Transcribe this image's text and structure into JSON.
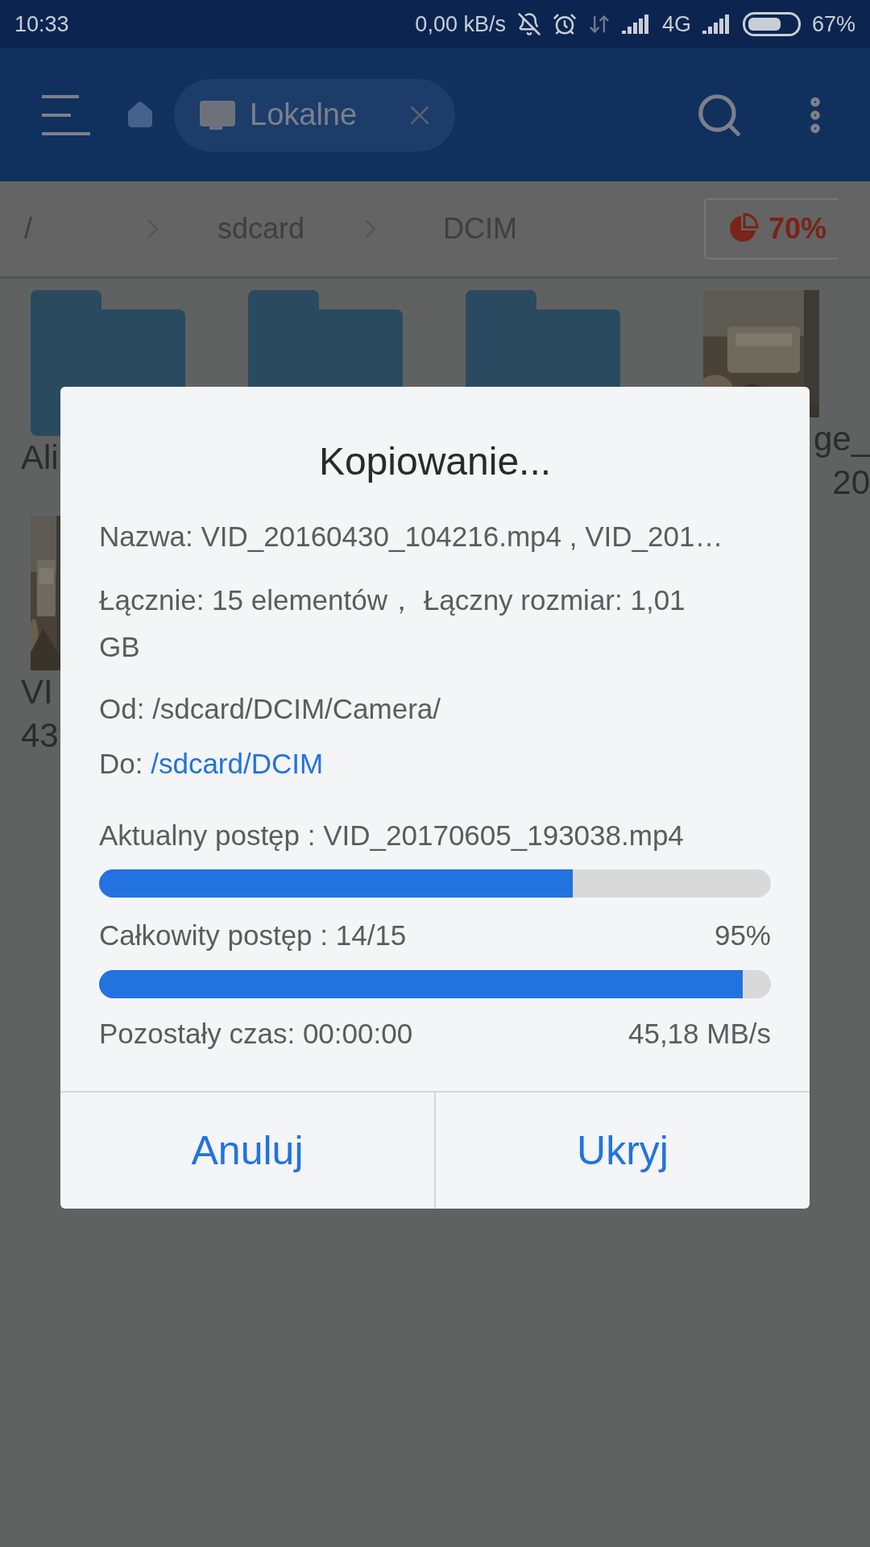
{
  "status_bar": {
    "time": "10:33",
    "net_speed": "0,00 kB/s",
    "network": "4G",
    "battery": "67%"
  },
  "toolbar": {
    "location_chip": "Lokalne"
  },
  "breadcrumb": {
    "items": [
      "/",
      "sdcard",
      "DCIM"
    ],
    "storage_usage": "70%"
  },
  "files": [
    {
      "kind": "folder",
      "label_lines": [
        "Ali"
      ]
    },
    {
      "kind": "folder"
    },
    {
      "kind": "folder"
    },
    {
      "kind": "picture",
      "label_lines": [
        "ge_",
        "20"
      ]
    },
    {
      "kind": "picture",
      "label_lines": [
        "VI",
        "43"
      ]
    }
  ],
  "dialog": {
    "title": "Kopiowanie...",
    "name": "Nazwa: VID_20160430_104216.mp4 , VID_201…",
    "total": "Łącznie: 15 elementów， Łączny rozmiar: 1,01 GB",
    "from": "Od: /sdcard/DCIM/Camera/",
    "to_label": "Do:",
    "to_path": "/sdcard/DCIM",
    "current": {
      "label": "Aktualny postęp : VID_20170605_193038.mp4",
      "level": 0.705
    },
    "overall": {
      "label": "Całkowity postęp : 14/15",
      "percent": "95%",
      "level": 0.958
    },
    "remaining": "Pozostały czas: 00:00:00",
    "speed": "45,18 MB/s",
    "buttons": [
      "Anuluj",
      "Ukryj"
    ]
  }
}
